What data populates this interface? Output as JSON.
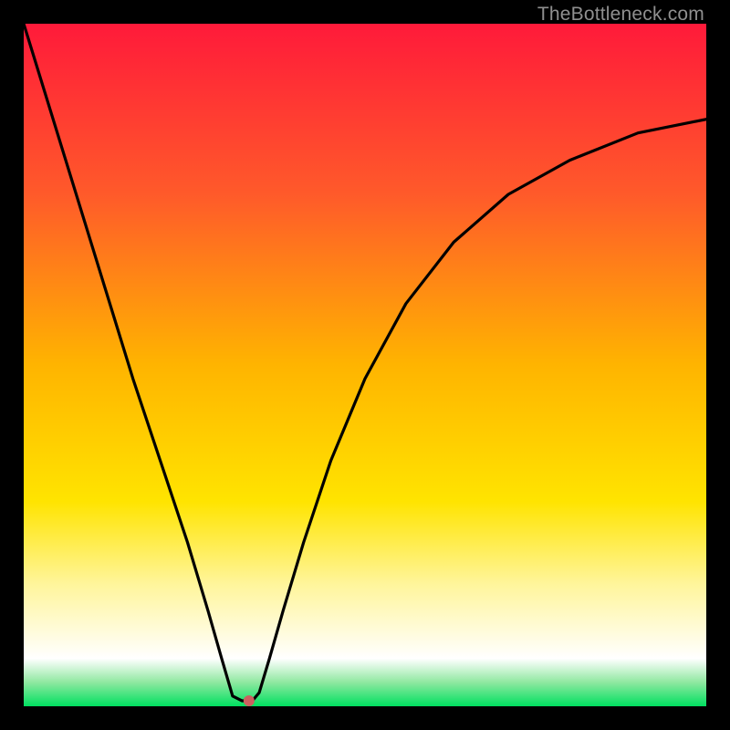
{
  "watermark": {
    "text": "TheBottleneck.com"
  },
  "chart_data": {
    "type": "line",
    "title": "",
    "xlabel": "",
    "ylabel": "",
    "xlim": [
      0,
      100
    ],
    "ylim": [
      0,
      100
    ],
    "background_gradient": {
      "stops": [
        {
          "offset": 0.0,
          "color": "#ff1a3a"
        },
        {
          "offset": 0.25,
          "color": "#ff5a2a"
        },
        {
          "offset": 0.5,
          "color": "#ffb400"
        },
        {
          "offset": 0.7,
          "color": "#ffe400"
        },
        {
          "offset": 0.82,
          "color": "#fff59a"
        },
        {
          "offset": 0.93,
          "color": "#ffffff"
        },
        {
          "offset": 0.965,
          "color": "#8fe8a0"
        },
        {
          "offset": 1.0,
          "color": "#00e060"
        }
      ]
    },
    "series": [
      {
        "name": "bottleneck-curve",
        "x": [
          0,
          4,
          8,
          12,
          16,
          20,
          24,
          27,
          29,
          30.6,
          32,
          33.5,
          34.5,
          36,
          38,
          41,
          45,
          50,
          56,
          63,
          71,
          80,
          90,
          100
        ],
        "values": [
          100,
          87,
          74,
          61,
          48,
          36,
          24,
          14,
          7,
          1.5,
          0.8,
          0.8,
          2,
          7,
          14,
          24,
          36,
          48,
          59,
          68,
          75,
          80,
          84,
          86
        ]
      }
    ],
    "marker": {
      "x": 33,
      "y": 0.8,
      "color": "#cc6060",
      "radius": 6
    }
  }
}
